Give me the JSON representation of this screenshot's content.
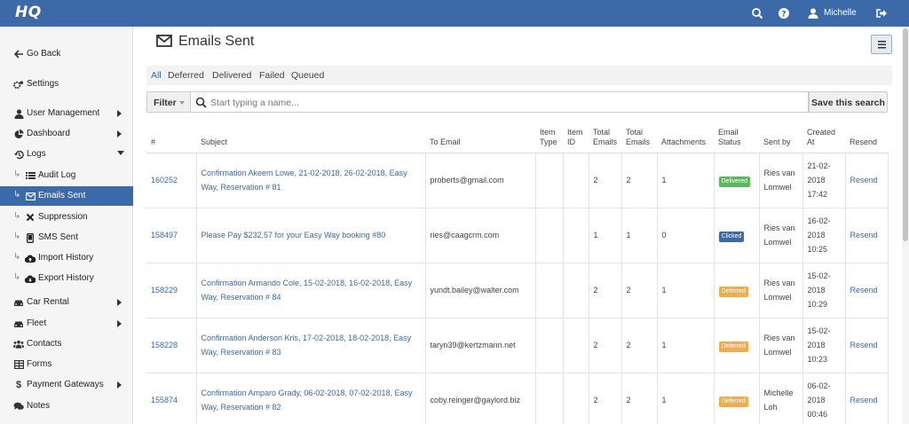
{
  "app": {
    "logo": "HQ",
    "user": "Michelle"
  },
  "sidebar": {
    "items": [
      {
        "label": "Go Back"
      },
      {
        "label": "Settings"
      },
      {
        "label": "User Management"
      },
      {
        "label": "Dashboard"
      },
      {
        "label": "Logs"
      },
      {
        "label": "Audit Log"
      },
      {
        "label": "Emails Sent"
      },
      {
        "label": "Suppression"
      },
      {
        "label": "SMS Sent"
      },
      {
        "label": "Import History"
      },
      {
        "label": "Export History"
      },
      {
        "label": "Car Rental"
      },
      {
        "label": "Fleet"
      },
      {
        "label": "Contacts"
      },
      {
        "label": "Forms"
      },
      {
        "label": "Payment Gateways"
      },
      {
        "label": "Notes"
      }
    ]
  },
  "page": {
    "title": "Emails Sent"
  },
  "tabs": [
    {
      "label": "All"
    },
    {
      "label": "Deferred"
    },
    {
      "label": "Delivered"
    },
    {
      "label": "Failed"
    },
    {
      "label": "Queued"
    }
  ],
  "filter": {
    "label": "Filter",
    "placeholder": "Start typing a name...",
    "save_label": "Save this search"
  },
  "table": {
    "headers": [
      "#",
      "Subject",
      "To Email",
      "Item Type",
      "Item ID",
      "Total Emails",
      "Total Emails",
      "Attachments",
      "Email Status",
      "Sent by",
      "Created At",
      "Resend"
    ],
    "rows": [
      {
        "id": "160252",
        "subject": "Confirmation Akeem Lowe, 21-02-2018, 26-02-2018, Easy Way, Reservation # 81",
        "to": "proberts@gmail.com",
        "item_type": "",
        "item_id": "",
        "total1": "2",
        "total2": "2",
        "attachments": "1",
        "status": "Delivered",
        "sent_by": "Ries van Lomwel",
        "created": "21-02-2018 17:42",
        "resend": "Resend"
      },
      {
        "id": "158497",
        "subject": "Please Pay $232,57 for your Easy Way booking #80",
        "to": "ries@caagcrm.com",
        "item_type": "",
        "item_id": "",
        "total1": "1",
        "total2": "1",
        "attachments": "0",
        "status": "Clicked",
        "sent_by": "Ries van Lomwel",
        "created": "16-02-2018 10:25",
        "resend": "Resend"
      },
      {
        "id": "158229",
        "subject": "Confirmation Armando Cole, 15-02-2018, 16-02-2018, Easy Way, Reservation # 84",
        "to": "yundt.bailey@walter.com",
        "item_type": "",
        "item_id": "",
        "total1": "2",
        "total2": "2",
        "attachments": "1",
        "status": "Deferred",
        "sent_by": "Ries van Lomwel",
        "created": "15-02-2018 10:29",
        "resend": "Resend"
      },
      {
        "id": "158228",
        "subject": "Confirmation Anderson Kris, 17-02-2018, 18-02-2018, Easy Way, Reservation # 83",
        "to": "taryn39@kertzmann.net",
        "item_type": "",
        "item_id": "",
        "total1": "2",
        "total2": "2",
        "attachments": "1",
        "status": "Deferred",
        "sent_by": "Ries van Lomwel",
        "created": "15-02-2018 10:23",
        "resend": "Resend"
      },
      {
        "id": "155874",
        "subject": "Confirmation Amparo Grady, 06-02-2018, 07-02-2018, Easy Way, Reservation # 82",
        "to": "coby.reinger@gaylord.biz",
        "item_type": "",
        "item_id": "",
        "total1": "2",
        "total2": "2",
        "attachments": "1",
        "status": "Deferred",
        "sent_by": "Michelle Loh",
        "created": "06-02-2018 00:46",
        "resend": "Resend"
      }
    ]
  },
  "colors": {
    "brand": "#3c6aa8",
    "delivered": "#5cb85c",
    "clicked": "#3c6aa8",
    "deferred": "#f0ad4e"
  }
}
